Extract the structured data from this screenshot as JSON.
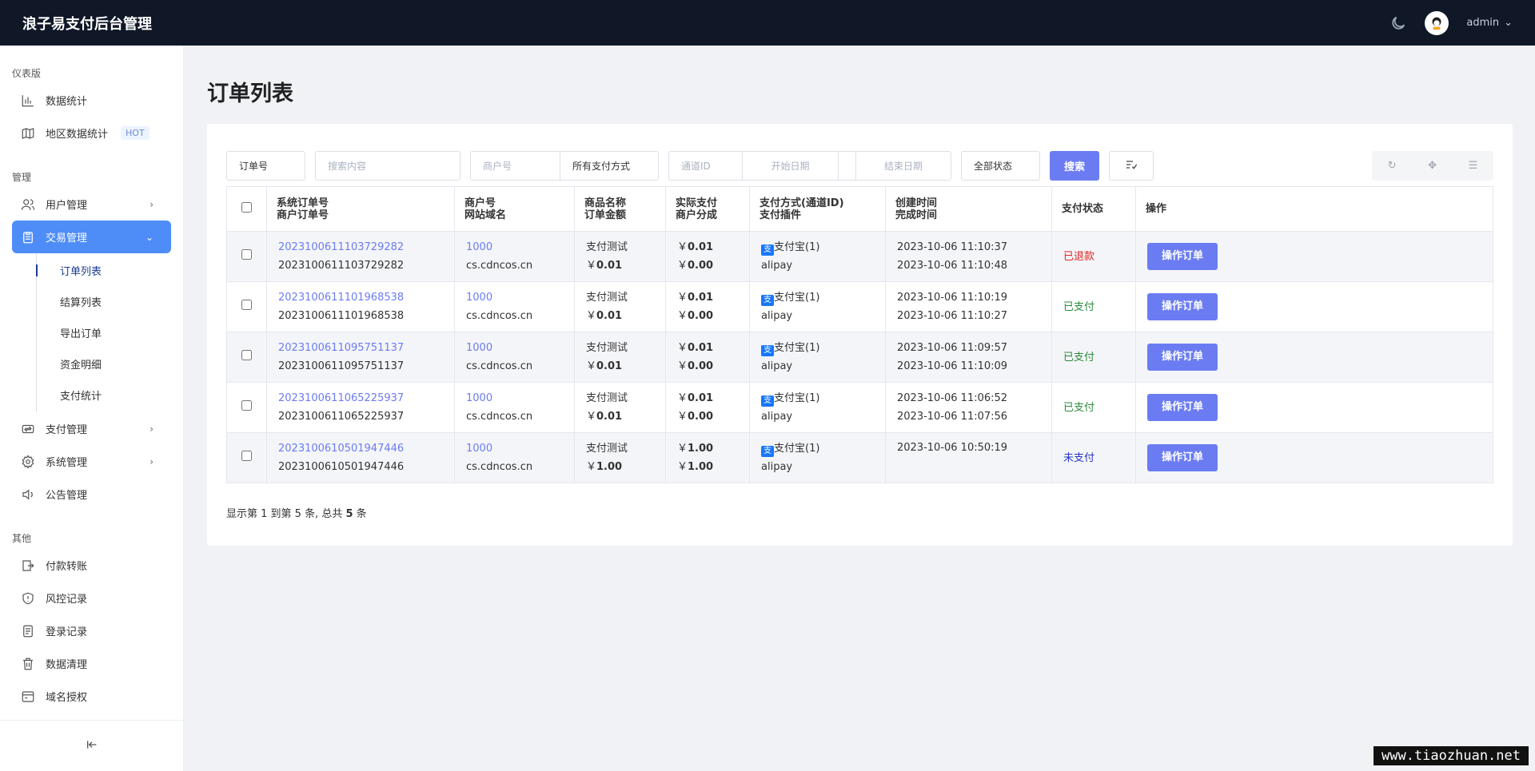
{
  "app": {
    "title": "浪子易支付后台管理",
    "user": "admin"
  },
  "sidebar": {
    "sections": [
      {
        "label": "仪表版",
        "items": [
          {
            "label": "数据统计",
            "icon": "bar-chart-icon"
          },
          {
            "label": "地区数据统计",
            "icon": "map-icon",
            "badge": "HOT"
          }
        ]
      },
      {
        "label": "管理",
        "items": [
          {
            "label": "用户管理",
            "icon": "users-icon"
          },
          {
            "label": "交易管理",
            "icon": "clipboard-icon",
            "active": true,
            "children": [
              "订单列表",
              "结算列表",
              "导出订单",
              "资金明细",
              "支付统计"
            ]
          },
          {
            "label": "支付管理",
            "icon": "payment-icon"
          },
          {
            "label": "系统管理",
            "icon": "gear-icon"
          },
          {
            "label": "公告管理",
            "icon": "speaker-icon"
          }
        ]
      },
      {
        "label": "其他",
        "items": [
          {
            "label": "付款转账",
            "icon": "transfer-icon"
          },
          {
            "label": "风控记录",
            "icon": "shield-icon"
          },
          {
            "label": "登录记录",
            "icon": "log-icon"
          },
          {
            "label": "数据清理",
            "icon": "trash-icon"
          },
          {
            "label": "域名授权",
            "icon": "domain-icon"
          }
        ]
      }
    ]
  },
  "page": {
    "title": "订单列表"
  },
  "filters": {
    "order_field": "订单号",
    "search_placeholder": "搜索内容",
    "merchant_placeholder": "商户号",
    "pay_type": "所有支付方式",
    "channel_placeholder": "通道ID",
    "start_placeholder": "开始日期",
    "end_placeholder": "结束日期",
    "status": "全部状态",
    "search_label": "搜索"
  },
  "table": {
    "headers": [
      [
        "系统订单号",
        "商户订单号"
      ],
      [
        "商户号",
        "网站域名"
      ],
      [
        "商品名称",
        "订单金额"
      ],
      [
        "实际支付",
        "商户分成"
      ],
      [
        "支付方式(通道ID)",
        "支付插件"
      ],
      [
        "创建时间",
        "完成时间"
      ],
      [
        "支付状态"
      ],
      [
        "操作"
      ]
    ],
    "rows": [
      {
        "sys_no": "2023100611103729282",
        "trade_no": "2023100611103729282",
        "merchant": "1000",
        "domain": "cs.cdncos.cn",
        "product": "支付测试",
        "amount": "0.01",
        "paid": "0.01",
        "share": "0.00",
        "pay_method": "支付宝(1)",
        "plugin": "alipay",
        "created": "2023-10-06 11:10:37",
        "finished": "2023-10-06 11:10:48",
        "status": "已退款",
        "status_key": "refund",
        "action": "操作订单"
      },
      {
        "sys_no": "2023100611101968538",
        "trade_no": "2023100611101968538",
        "merchant": "1000",
        "domain": "cs.cdncos.cn",
        "product": "支付测试",
        "amount": "0.01",
        "paid": "0.01",
        "share": "0.00",
        "pay_method": "支付宝(1)",
        "plugin": "alipay",
        "created": "2023-10-06 11:10:19",
        "finished": "2023-10-06 11:10:27",
        "status": "已支付",
        "status_key": "paid",
        "action": "操作订单"
      },
      {
        "sys_no": "2023100611095751137",
        "trade_no": "2023100611095751137",
        "merchant": "1000",
        "domain": "cs.cdncos.cn",
        "product": "支付测试",
        "amount": "0.01",
        "paid": "0.01",
        "share": "0.00",
        "pay_method": "支付宝(1)",
        "plugin": "alipay",
        "created": "2023-10-06 11:09:57",
        "finished": "2023-10-06 11:10:09",
        "status": "已支付",
        "status_key": "paid",
        "action": "操作订单"
      },
      {
        "sys_no": "2023100611065225937",
        "trade_no": "2023100611065225937",
        "merchant": "1000",
        "domain": "cs.cdncos.cn",
        "product": "支付测试",
        "amount": "0.01",
        "paid": "0.01",
        "share": "0.00",
        "pay_method": "支付宝(1)",
        "plugin": "alipay",
        "created": "2023-10-06 11:06:52",
        "finished": "2023-10-06 11:07:56",
        "status": "已支付",
        "status_key": "paid",
        "action": "操作订单"
      },
      {
        "sys_no": "2023100610501947446",
        "trade_no": "2023100610501947446",
        "merchant": "1000",
        "domain": "cs.cdncos.cn",
        "product": "支付测试",
        "amount": "1.00",
        "paid": "1.00",
        "share": "1.00",
        "pay_method": "支付宝(1)",
        "plugin": "alipay",
        "created": "2023-10-06 10:50:19",
        "finished": "",
        "status": "未支付",
        "status_key": "unpaid",
        "action": "操作订单"
      }
    ],
    "currency": "￥",
    "alipay_glyph": "支"
  },
  "pagination": {
    "prefix": "显示第 1 到第 5 条, 总共 ",
    "total": "5",
    "suffix": " 条"
  },
  "watermark": "www.tiaozhuan.net",
  "colors": {
    "topbar": "#101828",
    "accent": "#6b7cf3",
    "sidebar_active": "#4e8df7",
    "refund": "#e02424",
    "paid": "#2d8a3c",
    "unpaid": "#2636c8"
  }
}
